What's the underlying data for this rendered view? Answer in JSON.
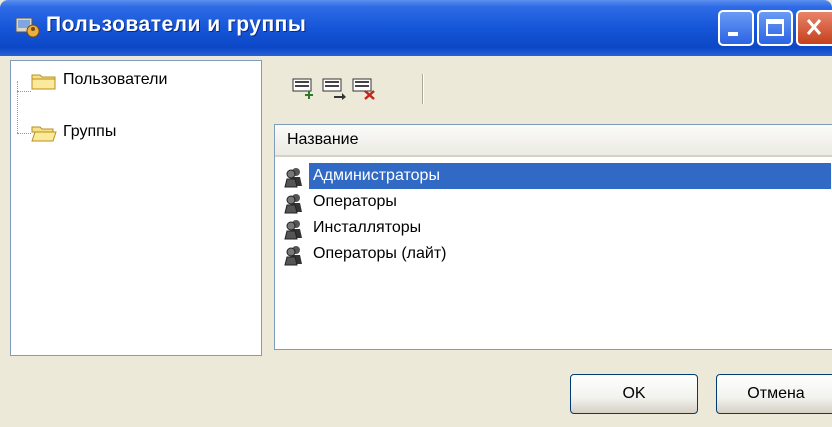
{
  "window": {
    "title": "Пользователи и группы",
    "controls": [
      "minimize-icon",
      "maximize-icon",
      "close-icon"
    ]
  },
  "tree": {
    "items": [
      {
        "label": "Пользователи",
        "icon": "folder-icon"
      },
      {
        "label": "Группы",
        "icon": "folder-open-icon"
      }
    ]
  },
  "toolbar": {
    "buttons": [
      {
        "icon": "add-group-icon"
      },
      {
        "icon": "edit-group-icon"
      },
      {
        "icon": "delete-group-icon"
      }
    ]
  },
  "list": {
    "column_header": "Название",
    "rows": [
      {
        "label": "Администраторы",
        "selected": true
      },
      {
        "label": "Операторы",
        "selected": false
      },
      {
        "label": "Инсталляторы",
        "selected": false
      },
      {
        "label": "Операторы (лайт)",
        "selected": false
      }
    ]
  },
  "buttons": {
    "ok": "OK",
    "cancel": "Отмена"
  },
  "colors": {
    "titlebar": "#0c47c6",
    "selection": "#316ac5",
    "face": "#ece9d8"
  }
}
